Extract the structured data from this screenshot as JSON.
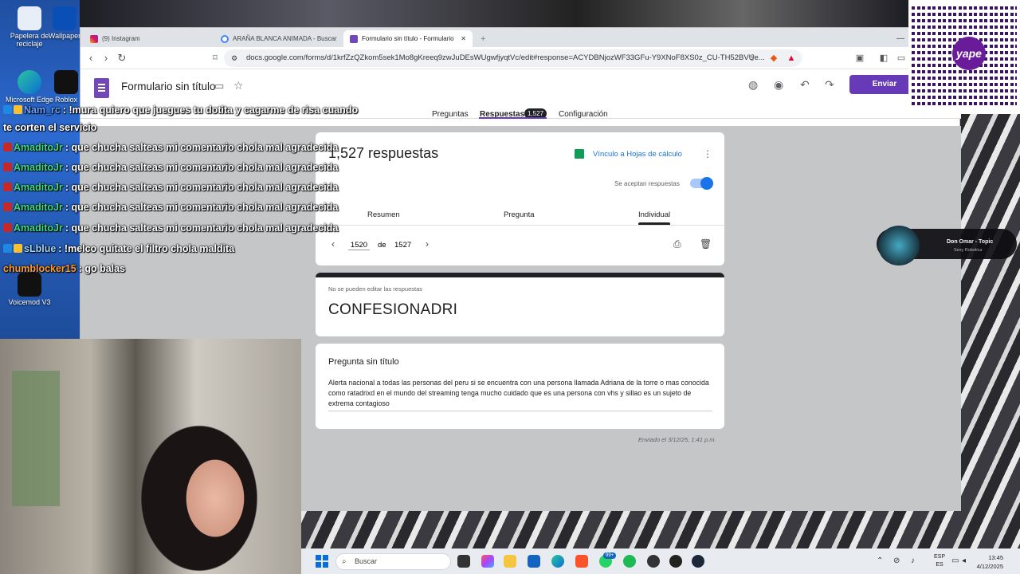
{
  "desktop": {
    "icons": [
      {
        "label": "Papelera de reciclaje"
      },
      {
        "label": "Wallpaper"
      },
      {
        "label": "Microsoft Edge"
      },
      {
        "label": "Roblox"
      },
      {
        "label": "Voicemod V3"
      }
    ]
  },
  "browser": {
    "tabs": [
      {
        "label": "(9) Instagram"
      },
      {
        "label": "ARAÑA BLANCA ANIMADA - Buscar"
      },
      {
        "label": "Formulario sin título - Formulario"
      }
    ],
    "new_tab": "+",
    "url": "docs.google.com/forms/d/1krfZzQZkom5sek1Mo8gKreeq9zwJuDEsWUgwfjyqtVc/edit#response=ACYDBNjozWF33GFu-Y9XNoF8XS0z_CU-TH52BVUe..."
  },
  "form": {
    "title": "Formulario sin título",
    "send_label": "Enviar",
    "tabs": {
      "questions": "Preguntas",
      "responses": "Respuestas",
      "responses_count": "1,527",
      "settings": "Configuración"
    },
    "responses_title": "1,527 respuestas",
    "sheets_link": "Vínculo a Hojas de cálculo",
    "accepting_label": "Se aceptan respuestas",
    "accepting": true,
    "subtabs": {
      "summary": "Resumen",
      "question": "Pregunta",
      "individual": "Individual"
    },
    "pager": {
      "current": "1520",
      "of": "de",
      "total": "1527"
    },
    "readonly_note": "No se pueden editar las respuestas",
    "response_name": "CONFESIONADRI",
    "question_title": "Pregunta sin título",
    "answer": "Alerta nacional a todas las personas del peru si se encuentra con una persona llamada Adriana de la torre o mas conocida como ratadrixd en el mundo del streaming tenga mucho cuidado que es una persona con vhs y sillao es un sujeto de extrema contagioso",
    "sent_at": "Enviado el 3/12/25, 1:41 p.m."
  },
  "chat": [
    {
      "user": "Nam_rc",
      "text": ": !mura quiero que juegues tu dotita y cagarme de risa cuando",
      "color": "#6aa3ff"
    },
    {
      "user": "",
      "text": "te corten el servicio",
      "color": "#ffffff"
    },
    {
      "user": "AmaditoJr",
      "text": ": que chucha salteas mi comentario chola mal agradecida",
      "color": "#3ddc84"
    },
    {
      "user": "AmaditoJr",
      "text": ": que chucha salteas mi comentario chola mal agradecida",
      "color": "#3ddc84"
    },
    {
      "user": "AmaditoJr",
      "text": ": que chucha salteas mi comentario chola mal agradecida",
      "color": "#3ddc84"
    },
    {
      "user": "AmaditoJr",
      "text": ": que chucha salteas mi comentario chola mal agradecida",
      "color": "#3ddc84"
    },
    {
      "user": "AmaditoJr",
      "text": ": que chucha salteas mi comentario chola mal agradecida",
      "color": "#3ddc84"
    },
    {
      "user": "sLblue",
      "text": ": !melco quitate el filtro chola maldita",
      "color": "#9bd7ff"
    },
    {
      "user": "chumblocker15",
      "text": ": go balas",
      "color": "#ff9a2e"
    }
  ],
  "qr": {
    "badge": "yape"
  },
  "music": {
    "title": "Don Omar - Topic",
    "subtitle": "Sexy Robotica"
  },
  "taskbar": {
    "search_placeholder": "Buscar",
    "badge": "99+",
    "lang": "ESP",
    "lang_sub": "ES",
    "time": "13:45",
    "date": "4/12/2025"
  }
}
